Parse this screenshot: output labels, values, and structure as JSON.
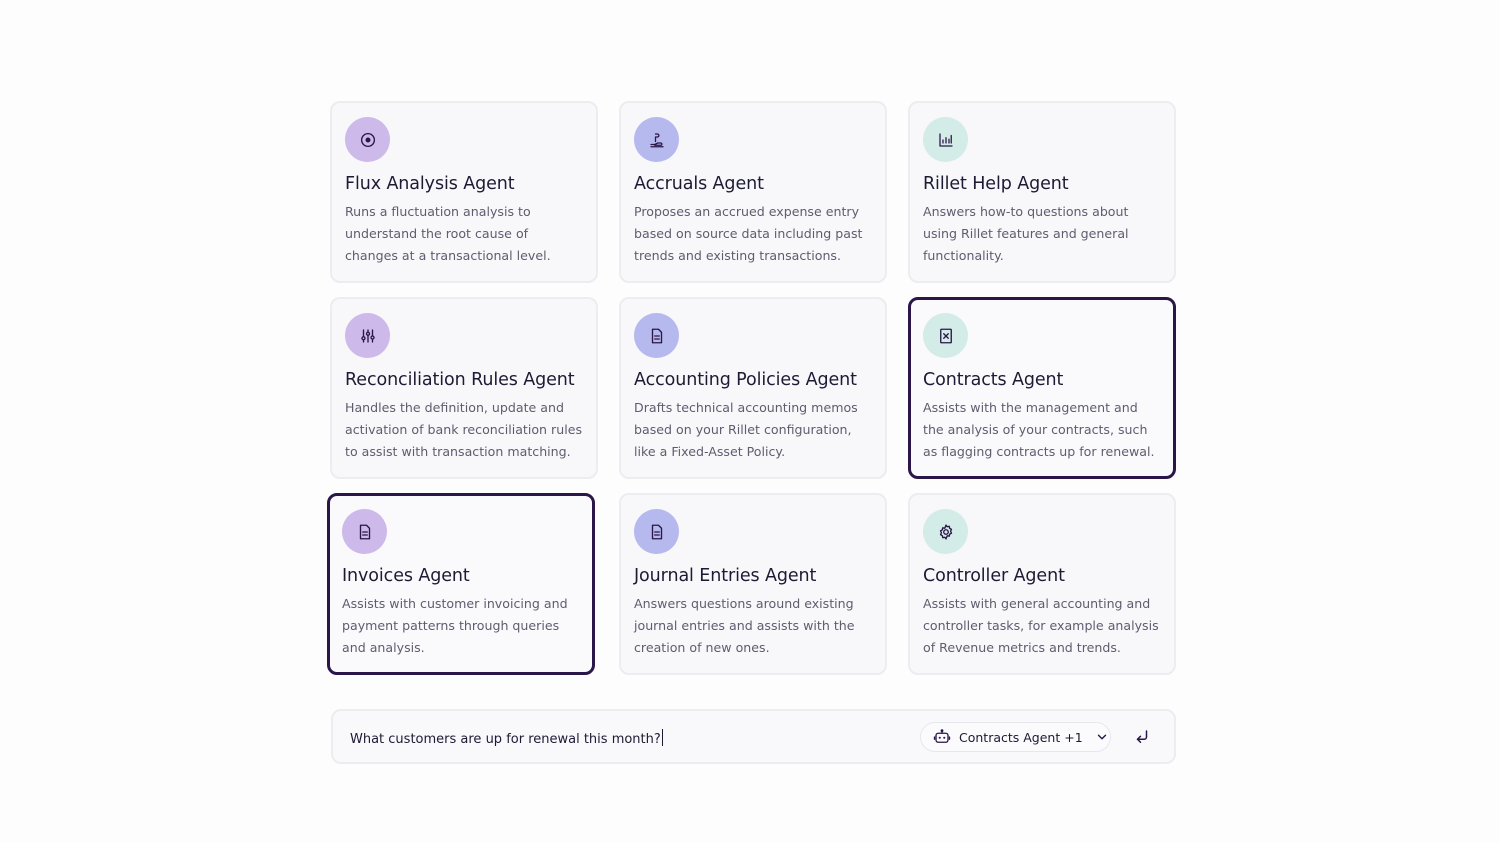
{
  "agents": [
    {
      "title": "Flux Analysis Agent",
      "description": "Runs a fluctuation analysis to understand the root cause of changes at a transactional level.",
      "icon": "target-icon",
      "icon_color": "#cdb9ea"
    },
    {
      "title": "Accruals Agent",
      "description": "Proposes an accrued expense entry based on source data including past trends and existing transactions.",
      "icon": "money-hand-icon",
      "icon_color": "#b6b9ed"
    },
    {
      "title": "Rillet Help Agent",
      "description": "Answers how-to questions about using Rillet features and general functionality.",
      "icon": "chart-icon",
      "icon_color": "#d3ece7"
    },
    {
      "title": "Reconciliation Rules Agent",
      "description": "Handles the definition, update and activation of bank reconciliation rules to assist with transaction matching.",
      "icon": "sliders-icon",
      "icon_color": "#cdb9ea"
    },
    {
      "title": "Accounting Policies Agent",
      "description": "Drafts technical accounting memos based on your Rillet configuration, like a Fixed-Asset Policy.",
      "icon": "document-icon",
      "icon_color": "#b6b9ed"
    },
    {
      "title": "Contracts Agent",
      "description": "Assists with the management and the analysis of your contracts, such as flagging contracts up for renewal.",
      "icon": "contract-icon",
      "icon_color": "#d3ece7",
      "selected": true
    },
    {
      "title": "Invoices Agent",
      "description": "Assists with customer invoicing and payment patterns through queries and analysis.",
      "icon": "document-icon",
      "icon_color": "#cdb9ea",
      "selected": true
    },
    {
      "title": "Journal Entries Agent",
      "description": "Answers questions around existing journal entries and assists with the creation of new ones.",
      "icon": "document-icon",
      "icon_color": "#b6b9ed"
    },
    {
      "title": "Controller Agent",
      "description": "Assists with general accounting and controller tasks, for example analysis of Revenue metrics and trends.",
      "icon": "gear-icon",
      "icon_color": "#d3ece7"
    }
  ],
  "chat": {
    "query": "What customers are up for renewal this month?",
    "agent_selector_label": "Contracts Agent +1",
    "agent_selector_icon": "robot-icon",
    "send_icon": "return-arrow-icon"
  },
  "colors": {
    "selected_border": "#2a1648",
    "icon_stroke": "#2a1648"
  }
}
